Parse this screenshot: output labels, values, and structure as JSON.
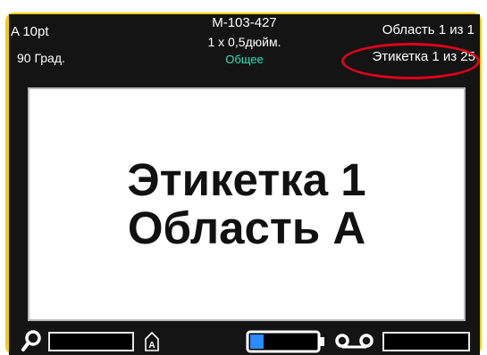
{
  "status_bar": {
    "font_size": "A 10pt",
    "rotation": "90 Град.",
    "part_number": "M-103-427",
    "label_size": "1 х 0,5дюйм.",
    "mode": "Общее",
    "area_counter": "Область 1 из 1",
    "label_counter": "Этикетка 1 из 25"
  },
  "editor": {
    "line1": "Этикетка 1",
    "line2": "Область A"
  },
  "toolbar": {
    "icons": [
      "zoom-icon",
      "print-quantity-icon",
      "battery-icon",
      "ribbon-cassette-icon"
    ],
    "battery_level": 0.2
  },
  "colors": {
    "bezel": "#f0d000",
    "screen_bg": "#141414",
    "mode_text": "#2fe3b8",
    "highlight": "#e0001b",
    "battery_fill": "#2a8cff"
  }
}
